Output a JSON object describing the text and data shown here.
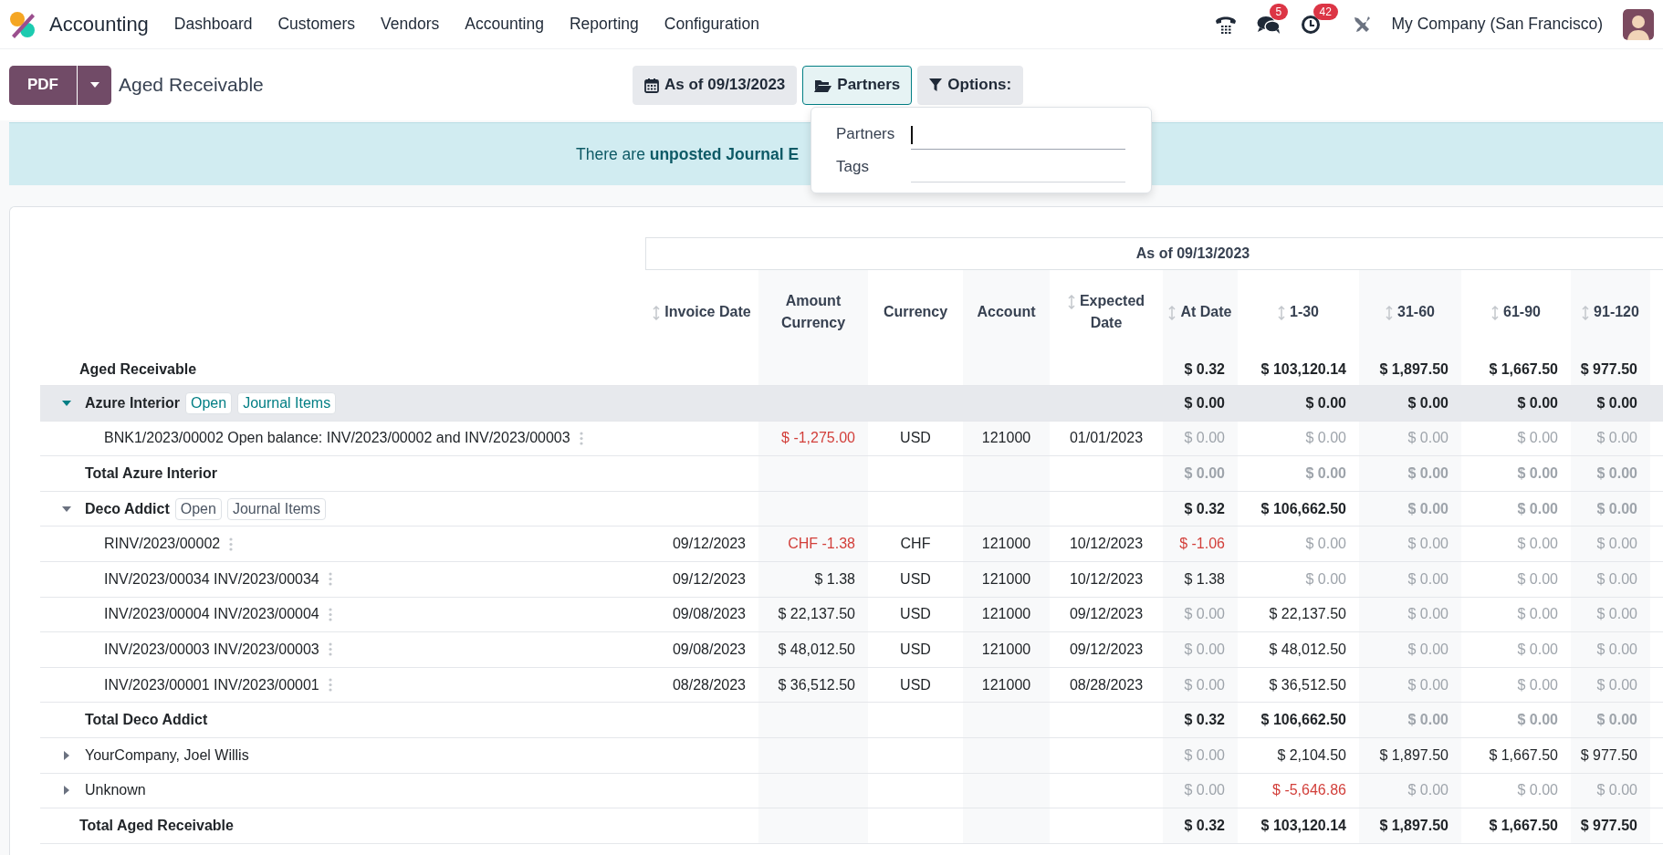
{
  "navbar": {
    "app_name": "Accounting",
    "menu": [
      "Dashboard",
      "Customers",
      "Vendors",
      "Accounting",
      "Reporting",
      "Configuration"
    ],
    "messages_badge": "5",
    "activities_badge": "42",
    "company": "My Company (San Francisco)"
  },
  "control_panel": {
    "print_button": "PDF",
    "title": "Aged Receivable",
    "filters": [
      {
        "label": "As of 09/13/2023",
        "kind": "date",
        "selected": false
      },
      {
        "label": "Partners",
        "kind": "partners",
        "selected": true
      },
      {
        "label": "Options:",
        "kind": "options",
        "selected": false
      }
    ]
  },
  "banner": {
    "text": "There are **unposted Journal E**"
  },
  "partner_dropdown": {
    "fields": [
      {
        "label": "Partners",
        "focused": true
      },
      {
        "label": "Tags",
        "focused": false
      }
    ]
  },
  "report": {
    "period": "As of 09/13/2023",
    "columns": [
      {
        "label": "Invoice Date",
        "sortable": true
      },
      {
        "label": "Amount Currency",
        "sortable": false
      },
      {
        "label": "Currency",
        "sortable": false
      },
      {
        "label": "Account",
        "sortable": false
      },
      {
        "label": "Expected Date",
        "sortable": true
      },
      {
        "label": "At Date",
        "sortable": true
      },
      {
        "label": "1-30",
        "sortable": true
      },
      {
        "label": "31-60",
        "sortable": true
      },
      {
        "label": "61-90",
        "sortable": true
      },
      {
        "label": "91-120",
        "sortable": true
      }
    ],
    "rows": [
      {
        "kind": "header",
        "label": "Aged Receivable",
        "aging": [
          {
            "value": "$ 0.32",
            "kind": "normal"
          },
          {
            "value": "$ 103,120.14",
            "kind": "normal"
          },
          {
            "value": "$ 1,897.50",
            "kind": "normal"
          },
          {
            "value": "$ 1,667.50",
            "kind": "normal"
          },
          {
            "value": "$ 977.50",
            "kind": "normal"
          }
        ]
      },
      {
        "kind": "group",
        "label": "Azure Interior",
        "expanded": true,
        "selected": true,
        "actions": [
          "Open",
          "Journal Items"
        ],
        "aging": [
          {
            "value": "$ 0.00",
            "kind": "normal"
          },
          {
            "value": "$ 0.00",
            "kind": "normal"
          },
          {
            "value": "$ 0.00",
            "kind": "normal"
          },
          {
            "value": "$ 0.00",
            "kind": "normal"
          },
          {
            "value": "$ 0.00",
            "kind": "normal"
          }
        ]
      },
      {
        "kind": "line",
        "label": "BNK1/2023/00002 Open balance: INV/2023/00002 and INV/2023/00003",
        "amount_currency": {
          "value": "$ -1,275.00",
          "kind": "negative"
        },
        "currency": "USD",
        "account": "121000",
        "expected_date": "01/01/2023",
        "aging": [
          {
            "value": "$ 0.00",
            "kind": "muted"
          },
          {
            "value": "$ 0.00",
            "kind": "muted"
          },
          {
            "value": "$ 0.00",
            "kind": "muted"
          },
          {
            "value": "$ 0.00",
            "kind": "muted"
          },
          {
            "value": "$ 0.00",
            "kind": "muted"
          }
        ]
      },
      {
        "kind": "total",
        "label": "Total Azure Interior",
        "aging": [
          {
            "value": "$ 0.00",
            "kind": "muted"
          },
          {
            "value": "$ 0.00",
            "kind": "muted"
          },
          {
            "value": "$ 0.00",
            "kind": "muted"
          },
          {
            "value": "$ 0.00",
            "kind": "muted"
          },
          {
            "value": "$ 0.00",
            "kind": "muted"
          }
        ]
      },
      {
        "kind": "group",
        "label": "Deco Addict",
        "expanded": true,
        "selected": false,
        "actions": [
          "Open",
          "Journal Items"
        ],
        "aging": [
          {
            "value": "$ 0.32",
            "kind": "normal"
          },
          {
            "value": "$ 106,662.50",
            "kind": "normal"
          },
          {
            "value": "$ 0.00",
            "kind": "muted"
          },
          {
            "value": "$ 0.00",
            "kind": "muted"
          },
          {
            "value": "$ 0.00",
            "kind": "muted"
          }
        ]
      },
      {
        "kind": "line",
        "label": "RINV/2023/00002",
        "invoice_date": "09/12/2023",
        "amount_currency": {
          "value": "CHF -1.38",
          "kind": "negative"
        },
        "currency": "CHF",
        "account": "121000",
        "expected_date": "10/12/2023",
        "aging": [
          {
            "value": "$ -1.06",
            "kind": "negative"
          },
          {
            "value": "$ 0.00",
            "kind": "muted"
          },
          {
            "value": "$ 0.00",
            "kind": "muted"
          },
          {
            "value": "$ 0.00",
            "kind": "muted"
          },
          {
            "value": "$ 0.00",
            "kind": "muted"
          }
        ]
      },
      {
        "kind": "line",
        "label": "INV/2023/00034 INV/2023/00034",
        "invoice_date": "09/12/2023",
        "amount_currency": {
          "value": "$ 1.38",
          "kind": "normal"
        },
        "currency": "USD",
        "account": "121000",
        "expected_date": "10/12/2023",
        "aging": [
          {
            "value": "$ 1.38",
            "kind": "normal"
          },
          {
            "value": "$ 0.00",
            "kind": "muted"
          },
          {
            "value": "$ 0.00",
            "kind": "muted"
          },
          {
            "value": "$ 0.00",
            "kind": "muted"
          },
          {
            "value": "$ 0.00",
            "kind": "muted"
          }
        ]
      },
      {
        "kind": "line",
        "label": "INV/2023/00004 INV/2023/00004",
        "invoice_date": "09/08/2023",
        "amount_currency": {
          "value": "$ 22,137.50",
          "kind": "normal"
        },
        "currency": "USD",
        "account": "121000",
        "expected_date": "09/12/2023",
        "aging": [
          {
            "value": "$ 0.00",
            "kind": "muted"
          },
          {
            "value": "$ 22,137.50",
            "kind": "normal"
          },
          {
            "value": "$ 0.00",
            "kind": "muted"
          },
          {
            "value": "$ 0.00",
            "kind": "muted"
          },
          {
            "value": "$ 0.00",
            "kind": "muted"
          }
        ]
      },
      {
        "kind": "line",
        "label": "INV/2023/00003 INV/2023/00003",
        "invoice_date": "09/08/2023",
        "amount_currency": {
          "value": "$ 48,012.50",
          "kind": "normal"
        },
        "currency": "USD",
        "account": "121000",
        "expected_date": "09/12/2023",
        "aging": [
          {
            "value": "$ 0.00",
            "kind": "muted"
          },
          {
            "value": "$ 48,012.50",
            "kind": "normal"
          },
          {
            "value": "$ 0.00",
            "kind": "muted"
          },
          {
            "value": "$ 0.00",
            "kind": "muted"
          },
          {
            "value": "$ 0.00",
            "kind": "muted"
          }
        ]
      },
      {
        "kind": "line",
        "label": "INV/2023/00001 INV/2023/00001",
        "invoice_date": "08/28/2023",
        "amount_currency": {
          "value": "$ 36,512.50",
          "kind": "normal"
        },
        "currency": "USD",
        "account": "121000",
        "expected_date": "08/28/2023",
        "aging": [
          {
            "value": "$ 0.00",
            "kind": "muted"
          },
          {
            "value": "$ 36,512.50",
            "kind": "normal"
          },
          {
            "value": "$ 0.00",
            "kind": "muted"
          },
          {
            "value": "$ 0.00",
            "kind": "muted"
          },
          {
            "value": "$ 0.00",
            "kind": "muted"
          }
        ]
      },
      {
        "kind": "total",
        "label": "Total Deco Addict",
        "aging": [
          {
            "value": "$ 0.32",
            "kind": "normal"
          },
          {
            "value": "$ 106,662.50",
            "kind": "normal"
          },
          {
            "value": "$ 0.00",
            "kind": "muted"
          },
          {
            "value": "$ 0.00",
            "kind": "muted"
          },
          {
            "value": "$ 0.00",
            "kind": "muted"
          }
        ]
      },
      {
        "kind": "group",
        "label": "YourCompany, Joel Willis",
        "expanded": false,
        "selected": false,
        "aging": [
          {
            "value": "$ 0.00",
            "kind": "muted"
          },
          {
            "value": "$ 2,104.50",
            "kind": "normal"
          },
          {
            "value": "$ 1,897.50",
            "kind": "normal"
          },
          {
            "value": "$ 1,667.50",
            "kind": "normal"
          },
          {
            "value": "$ 977.50",
            "kind": "normal"
          }
        ]
      },
      {
        "kind": "group",
        "label": "Unknown",
        "expanded": false,
        "selected": false,
        "aging": [
          {
            "value": "$ 0.00",
            "kind": "muted"
          },
          {
            "value": "$ -5,646.86",
            "kind": "negative"
          },
          {
            "value": "$ 0.00",
            "kind": "muted"
          },
          {
            "value": "$ 0.00",
            "kind": "muted"
          },
          {
            "value": "$ 0.00",
            "kind": "muted"
          }
        ]
      },
      {
        "kind": "grand_total",
        "label": "Total Aged Receivable",
        "aging": [
          {
            "value": "$ 0.32",
            "kind": "normal"
          },
          {
            "value": "$ 103,120.14",
            "kind": "normal"
          },
          {
            "value": "$ 1,897.50",
            "kind": "normal"
          },
          {
            "value": "$ 1,667.50",
            "kind": "normal"
          },
          {
            "value": "$ 977.50",
            "kind": "normal"
          }
        ]
      }
    ]
  }
}
